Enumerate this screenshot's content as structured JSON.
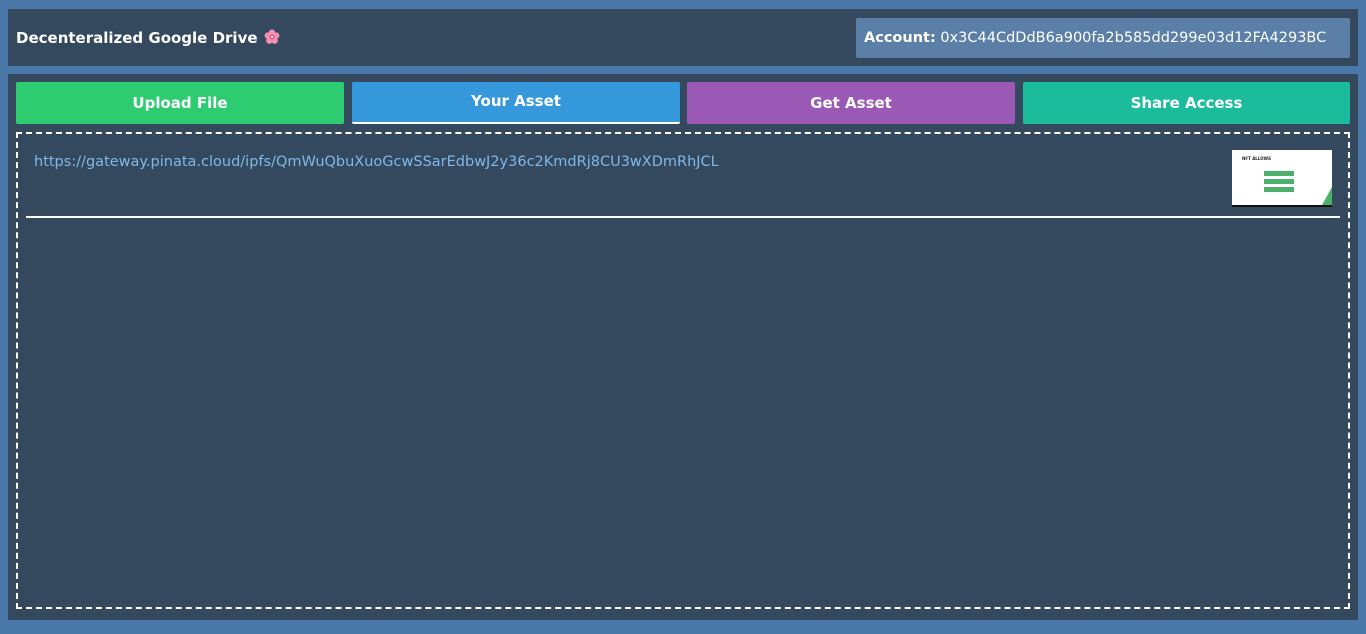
{
  "header": {
    "title": "Decenteralized Google Drive",
    "title_icon": "flower-icon",
    "account_label": "Account:",
    "account_address": "0x3C44CdDdB6a900fa2b585dd299e03d12FA4293BC"
  },
  "tabs": [
    {
      "label": "Upload File",
      "color": "#2ecc71"
    },
    {
      "label": "Your Asset",
      "color": "#3498db",
      "active": true
    },
    {
      "label": "Get Asset",
      "color": "#9b59b6"
    },
    {
      "label": "Share Access",
      "color": "#1abc9c"
    }
  ],
  "assets": [
    {
      "url": "https://gateway.pinata.cloud/ipfs/QmWuQbuXuoGcwSSarEdbwJ2y36c2KmdRj8CU3wXDmRhJCL",
      "thumbnail_title": "NFT ALLOWS"
    }
  ]
}
